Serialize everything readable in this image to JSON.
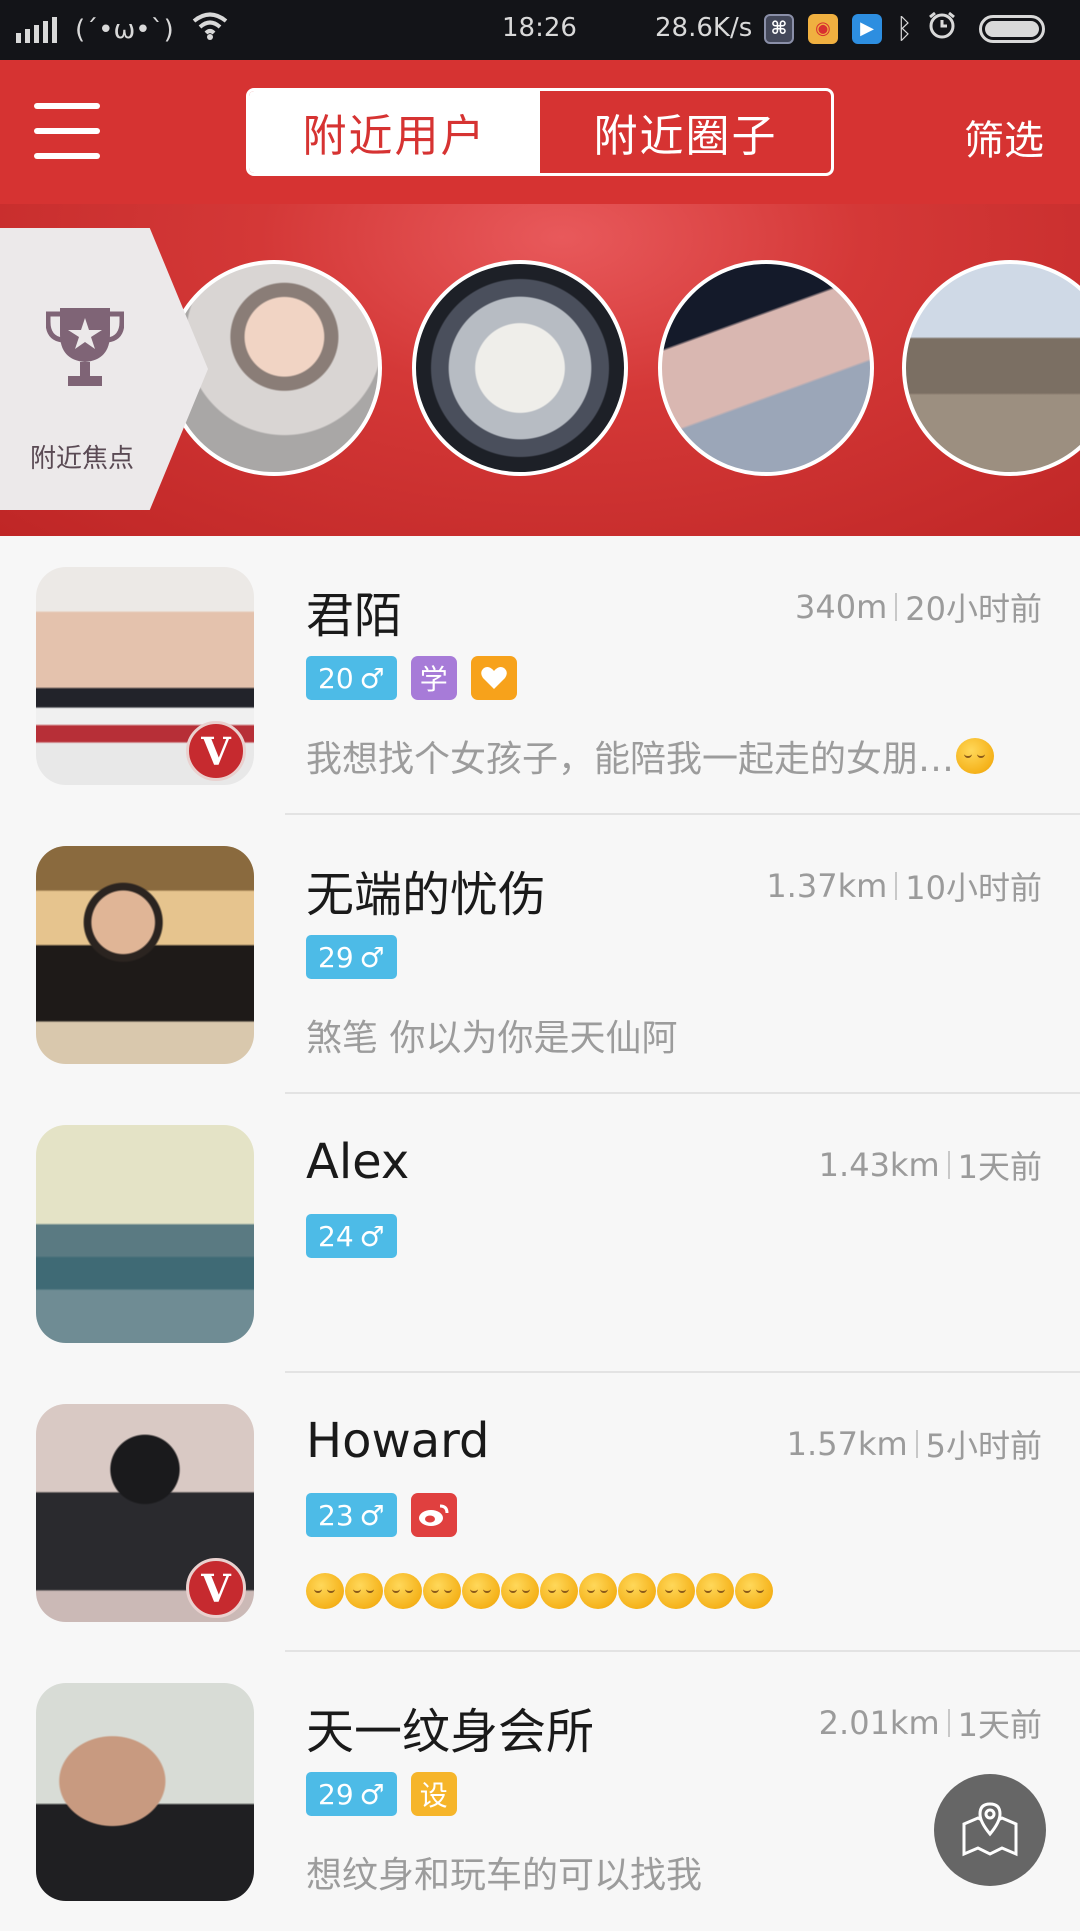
{
  "status_bar": {
    "signal_emoticon": "(´•ω•`)",
    "time": "18:26",
    "speed": "28.6K/s"
  },
  "header": {
    "tabs": [
      "附近用户",
      "附近圈子"
    ],
    "active_tab": 0,
    "filter_label": "筛选",
    "bg_color": "#d63332"
  },
  "focus": {
    "label": "附近焦点"
  },
  "users": [
    {
      "name": "君陌",
      "distance": "340m",
      "time": "20小时前",
      "age": "20",
      "gender_icon": "♂",
      "tags": [
        "学",
        "heart"
      ],
      "sign": "我想找个女孩子，能陪我一起走的女朋…",
      "verified": true
    },
    {
      "name": "无端的忧伤",
      "distance": "1.37km",
      "time": "10小时前",
      "age": "29",
      "gender_icon": "♂",
      "tags": [],
      "sign": "煞笔  你以为你是天仙阿",
      "verified": false
    },
    {
      "name": "Alex",
      "distance": "1.43km",
      "time": "1天前",
      "age": "24",
      "gender_icon": "♂",
      "tags": [],
      "sign": "",
      "verified": false
    },
    {
      "name": "Howard",
      "distance": "1.57km",
      "time": "5小时前",
      "age": "23",
      "gender_icon": "♂",
      "tags": [
        "weibo"
      ],
      "sign": "",
      "verified": true
    },
    {
      "name": "天一纹身会所",
      "distance": "2.01km",
      "time": "1天前",
      "age": "29",
      "gender_icon": "♂",
      "tags": [
        "设"
      ],
      "sign": "想纹身和玩车的可以找我",
      "verified": false
    }
  ],
  "colors": {
    "age_tag": "#4dbbe7",
    "student_tag": "#a77bd8",
    "heart_tag": "#f7a21b",
    "weibo_tag": "#e0403f",
    "design_tag": "#f6b52a"
  },
  "icons": [
    "menu-icon",
    "trophy-icon",
    "map-pin-icon",
    "emoji-smile-icon",
    "weibo-icon",
    "heart-icon"
  ]
}
